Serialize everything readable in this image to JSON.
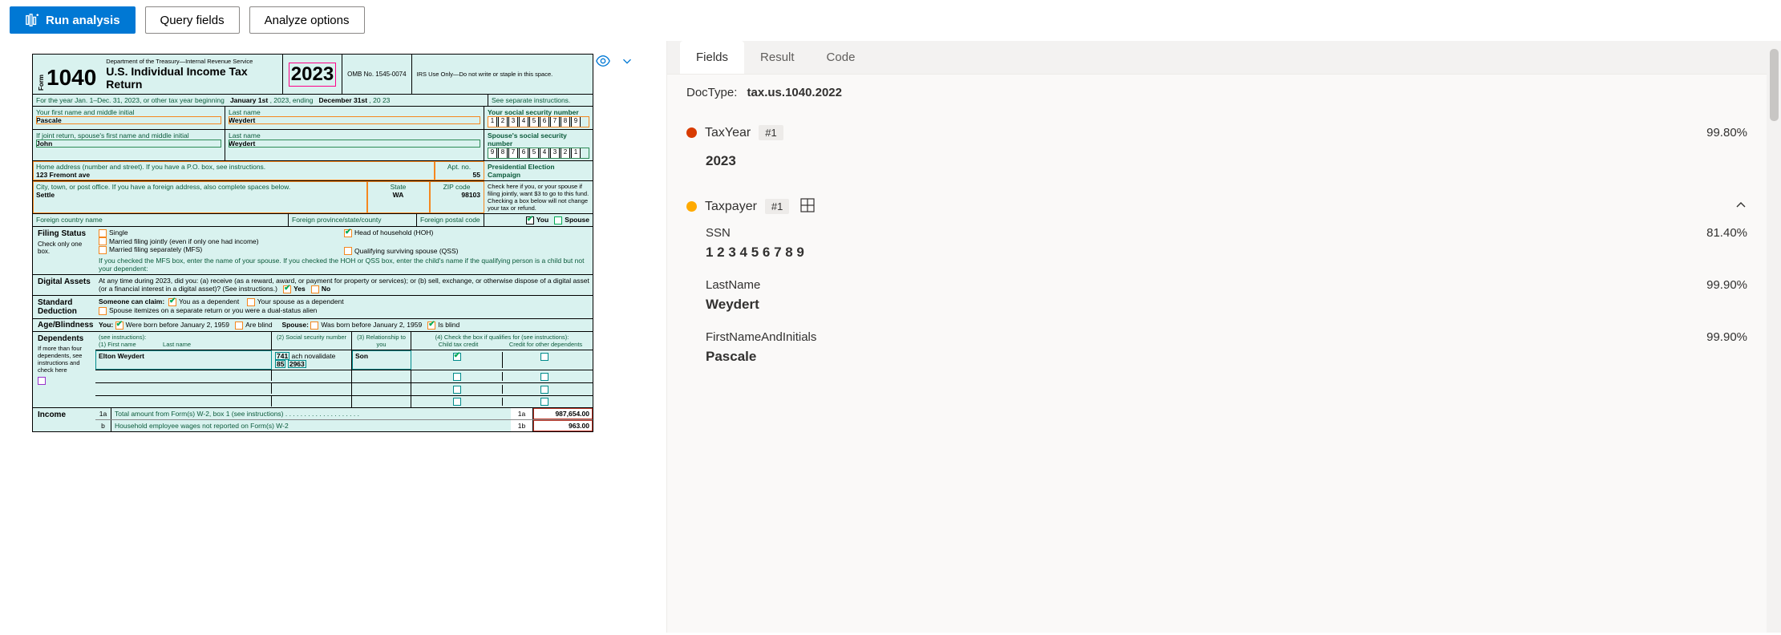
{
  "toolbar": {
    "run_analysis": "Run analysis",
    "query_fields": "Query fields",
    "analyze_options": "Analyze options"
  },
  "tabs": {
    "fields": "Fields",
    "result": "Result",
    "code": "Code"
  },
  "doctype_label": "DocType:",
  "doctype_value": "tax.us.1040.2022",
  "fields": [
    {
      "color": "red",
      "name": "TaxYear",
      "badge": "#1",
      "confidence": "99.80%",
      "value": "2023",
      "expandable": false
    },
    {
      "color": "orange",
      "name": "Taxpayer",
      "badge": "#1",
      "confidence": "",
      "value": "",
      "expandable": true,
      "grid": true,
      "subfields": [
        {
          "name": "SSN",
          "confidence": "81.40%",
          "value": "1 2 3 4 5 6 7 8 9"
        },
        {
          "name": "LastName",
          "confidence": "99.90%",
          "value": "Weydert"
        },
        {
          "name": "FirstNameAndInitials",
          "confidence": "99.90%",
          "value": "Pascale"
        }
      ]
    }
  ],
  "form": {
    "form_no_label": "Form",
    "form_no": "1040",
    "dept": "Department of the Treasury—Internal Revenue Service",
    "title": "U.S. Individual Income Tax Return",
    "year_prefix": "20",
    "year_suffix": "23",
    "omb": "OMB No. 1545-0074",
    "irs_use": "IRS Use Only—Do not write or staple in this space.",
    "tax_year_line": "For the year Jan. 1–Dec. 31, 2023, or other tax year beginning",
    "begin_date": "January 1st",
    "year_2023": ", 2023, ending",
    "end_date": "December 31st",
    "end_year": ", 20 23",
    "see_instructions": "See separate instructions.",
    "first_name_label": "Your first name and middle initial",
    "first_name": "Pascale",
    "last_name_label": "Last name",
    "last_name": "Weydert",
    "ssn_label": "Your social security number",
    "ssn": [
      "1",
      "2",
      "3",
      "4",
      "5",
      "6",
      "7",
      "8",
      "9"
    ],
    "spouse_first_label": "If joint return, spouse's first name and middle initial",
    "spouse_first": "John",
    "spouse_last_label": "Last name",
    "spouse_last": "Weydert",
    "spouse_ssn_label": "Spouse's social security number",
    "spouse_ssn": [
      "9",
      "8",
      "7",
      "6",
      "5",
      "4",
      "3",
      "2",
      "1"
    ],
    "home_addr_label": "Home address (number and street). If you have a P.O. box, see instructions.",
    "home_addr": "123 Fremont ave",
    "apt_label": "Apt. no.",
    "apt": "55",
    "city_label": "City, town, or post office. If you have a foreign address, also complete spaces below.",
    "city": "Settle",
    "state_label": "State",
    "state": "WA",
    "zip_label": "ZIP code",
    "zip": "98103",
    "foreign_country_label": "Foreign country name",
    "foreign_province_label": "Foreign province/state/county",
    "foreign_postal_label": "Foreign postal code",
    "pec_title": "Presidential Election Campaign",
    "pec_text": "Check here if you, or your spouse if filing jointly, want $3 to go to this fund. Checking a box below will not change your tax or refund.",
    "you": "You",
    "spouse": "Spouse",
    "filing_status_label": "Filing Status",
    "check_only": "Check only one box.",
    "fs_single": "Single",
    "fs_mfj": "Married filing jointly (even if only one had income)",
    "fs_mfs": "Married filing separately (MFS)",
    "fs_hoh": "Head of household (HOH)",
    "fs_qss": "Qualifying surviving spouse (QSS)",
    "fs_note": "If you checked the MFS box, enter the name of your spouse. If you checked the HOH or QSS box, enter the child's name if the qualifying person is a child but not your dependent:",
    "digital_label": "Digital Assets",
    "digital_text": "At any time during 2023, did you: (a) receive (as a reward, award, or payment for property or services); or (b) sell, exchange, or otherwise dispose of a digital asset (or a financial interest in a digital asset)? (See instructions.)",
    "yes": "Yes",
    "no": "No",
    "std_ded_label": "Standard Deduction",
    "someone_claim": "Someone can claim:",
    "you_dependent": "You as a dependent",
    "spouse_dependent": "Your spouse as a dependent",
    "spouse_itemizes": "Spouse itemizes on a separate return or you were a dual-status alien",
    "age_label": "Age/Blindness",
    "you_label": "You:",
    "born_before": "Were born before January 2, 1959",
    "are_blind": "Are blind",
    "spouse_label2": "Spouse:",
    "was_born_before": "Was born before January 2, 1959",
    "is_blind": "Is blind",
    "dependents_label": "Dependents",
    "dep_see": "(see instructions):",
    "dep_first": "(1) First name",
    "dep_last": "Last name",
    "dep_ssn": "(2) Social security number",
    "dep_rel": "(3) Relationship to you",
    "dep_check": "(4) Check the box if qualifies for (see instructions):",
    "dep_ctc": "Child tax credit",
    "dep_other": "Credit for other dependents",
    "dep_more": "If more than four dependents, see instructions and check here",
    "dep1_name": "Elton Weydert",
    "dep1_ssn1": "741",
    "dep1_ssn2": "85",
    "dep1_ssn3": "2963",
    "dep1_rel": "Son",
    "income_label": "Income",
    "line1a": "1a",
    "line1a_text": "Total amount from Form(s) W-2, box 1 (see instructions)",
    "line1a_box": "1a",
    "line1a_val": "987,654.00",
    "line1b": "b",
    "line1b_text": "Household employee wages not reported on Form(s) W-2",
    "line1b_box": "1b",
    "line1b_val": "963.00"
  }
}
